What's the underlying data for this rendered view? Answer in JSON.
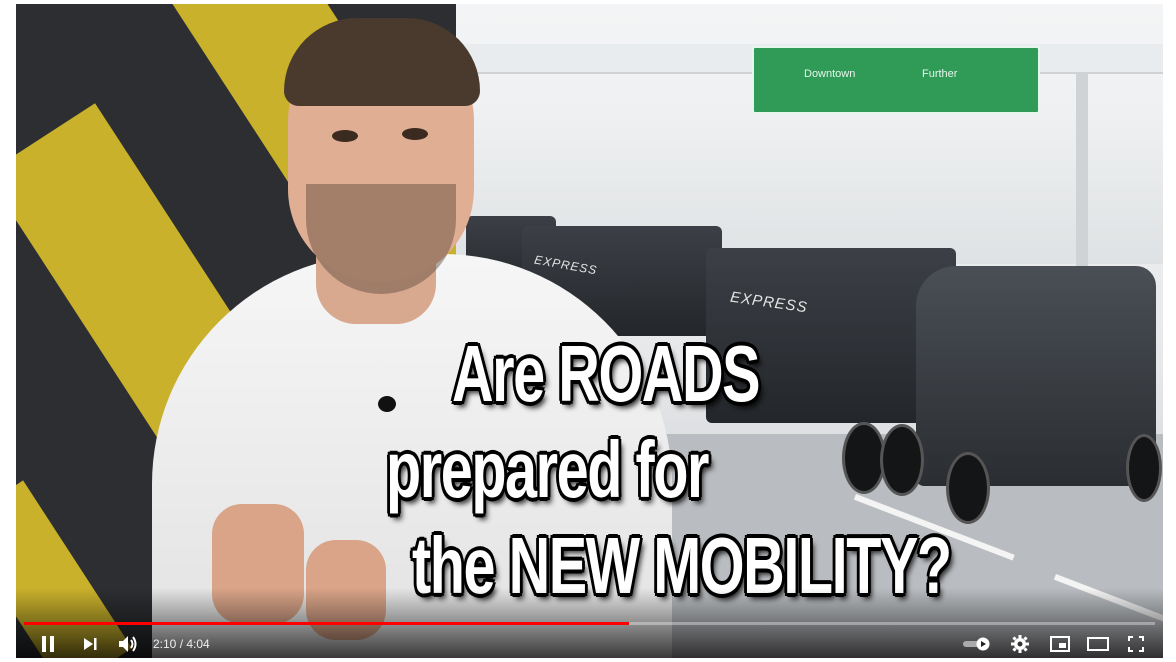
{
  "sign": {
    "left_destination": "Downtown",
    "right_destination": "Further"
  },
  "truck": {
    "label_front": "EXPRESS",
    "label_rear": "EXPRESS"
  },
  "thumbnail_title": {
    "line1": "Are ROADS",
    "line2": "prepared for",
    "line3": "the NEW MOBILITY?"
  },
  "player": {
    "current_time": "2:10",
    "duration": "4:04",
    "time_display": "2:10 / 4:04",
    "progress_fraction": 0.535,
    "progress_color": "#ff0000",
    "icons": {
      "play_pause": "pause-icon",
      "next": "next-icon",
      "volume": "volume-icon",
      "autoplay": "autoplay-toggle-icon",
      "settings": "gear-icon",
      "miniplayer": "miniplayer-icon",
      "theater": "theater-mode-icon",
      "fullscreen": "fullscreen-icon"
    }
  }
}
